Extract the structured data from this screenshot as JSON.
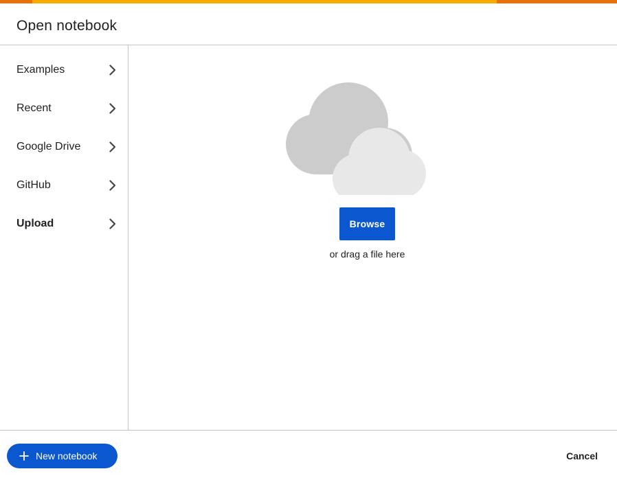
{
  "dialog": {
    "title": "Open notebook"
  },
  "sidebar": {
    "items": [
      {
        "label": "Examples",
        "active": false
      },
      {
        "label": "Recent",
        "active": false
      },
      {
        "label": "Google Drive",
        "active": false
      },
      {
        "label": "GitHub",
        "active": false
      },
      {
        "label": "Upload",
        "active": true
      }
    ]
  },
  "upload": {
    "browse_label": "Browse",
    "drag_text": "or drag a file here"
  },
  "footer": {
    "new_notebook_label": "New notebook",
    "cancel_label": "Cancel"
  },
  "icons": {
    "chevron": "chevron-right-icon",
    "upload_illustration": "cloud-icon",
    "new": "plus-icon"
  },
  "colors": {
    "primary": "#0b57d0",
    "accent_orange": "#e8710a",
    "accent_yellow": "#f9ab00",
    "divider": "#c6c6c6"
  }
}
